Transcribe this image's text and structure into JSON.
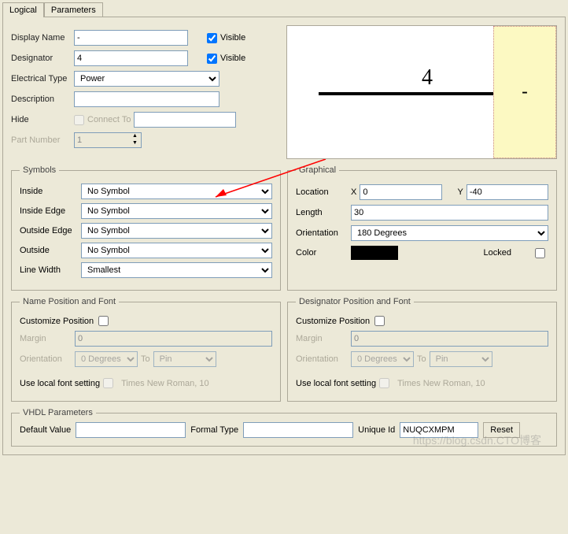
{
  "tabs": {
    "logical": "Logical",
    "parameters": "Parameters"
  },
  "fields": {
    "display_name_label": "Display Name",
    "display_name": "-",
    "visible1": "Visible",
    "designator_label": "Designator",
    "designator": "4",
    "visible2": "Visible",
    "electrical_type_label": "Electrical Type",
    "electrical_type": "Power",
    "description_label": "Description",
    "description": "",
    "hide_label": "Hide",
    "connect_to_label": "Connect To",
    "connect_to": "",
    "part_number_label": "Part Number",
    "part_number": "1"
  },
  "preview": {
    "num": "4",
    "name": "-"
  },
  "symbols": {
    "legend": "Symbols",
    "inside_label": "Inside",
    "inside": "No Symbol",
    "inside_edge_label": "Inside Edge",
    "inside_edge": "No Symbol",
    "outside_edge_label": "Outside Edge",
    "outside_edge": "No Symbol",
    "outside_label": "Outside",
    "outside": "No Symbol",
    "line_width_label": "Line Width",
    "line_width": "Smallest"
  },
  "graphical": {
    "legend": "Graphical",
    "location_label": "Location",
    "x_label": "X",
    "x": "0",
    "y_label": "Y",
    "y": "-40",
    "length_label": "Length",
    "length": "30",
    "orientation_label": "Orientation",
    "orientation": "180 Degrees",
    "color_label": "Color",
    "locked_label": "Locked"
  },
  "name_pos": {
    "legend": "Name Position and Font",
    "customize_label": "Customize Position",
    "margin_label": "Margin",
    "margin": "0",
    "orientation_label": "Orientation",
    "orientation": "0 Degrees",
    "to_label": "To",
    "to": "Pin",
    "use_local_label": "Use local font setting",
    "font_text": "Times New Roman, 10"
  },
  "desig_pos": {
    "legend": "Designator Position and Font",
    "customize_label": "Customize Position",
    "margin_label": "Margin",
    "margin": "0",
    "orientation_label": "Orientation",
    "orientation": "0 Degrees",
    "to_label": "To",
    "to": "Pin",
    "use_local_label": "Use local font setting",
    "font_text": "Times New Roman, 10"
  },
  "vhdl": {
    "legend": "VHDL Parameters",
    "default_value_label": "Default Value",
    "default_value": "",
    "formal_type_label": "Formal Type",
    "formal_type": "",
    "unique_id_label": "Unique Id",
    "unique_id": "NUQCXMPM",
    "reset_label": "Reset"
  },
  "watermark": "https://blog.csdn.CTO博客"
}
